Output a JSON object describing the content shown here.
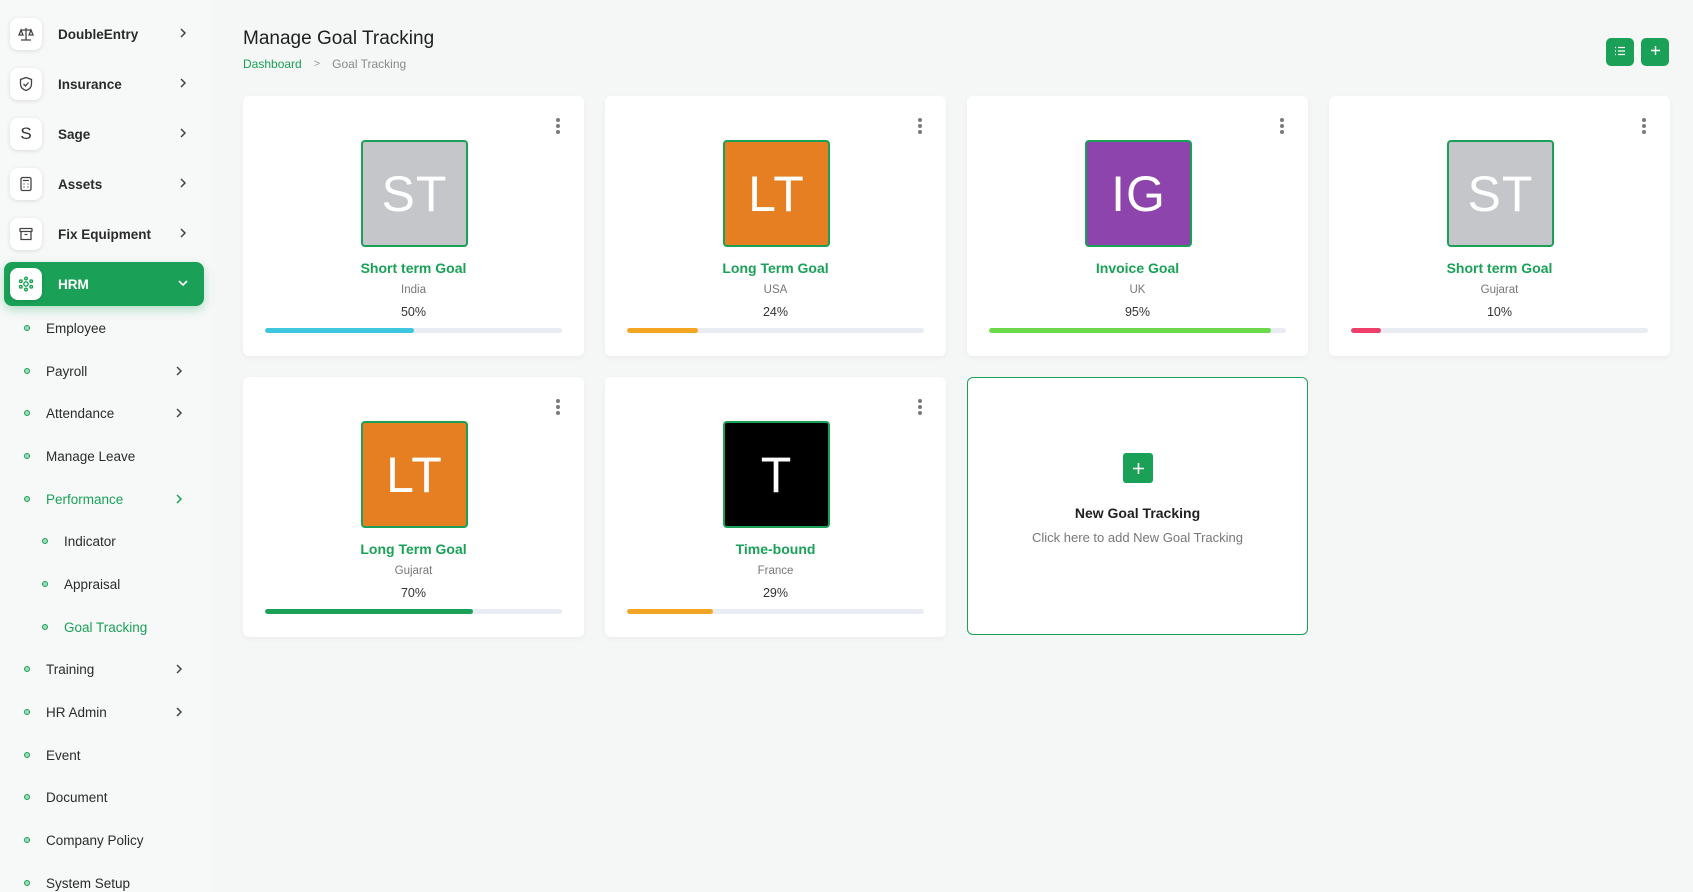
{
  "sidebar": {
    "top_items": [
      {
        "label": "DoubleEntry",
        "icon": "scale-icon"
      },
      {
        "label": "Insurance",
        "icon": "shield-icon"
      },
      {
        "label": "Sage",
        "icon": "sage-icon",
        "glyph": "S"
      },
      {
        "label": "Assets",
        "icon": "calculator-icon"
      },
      {
        "label": "Fix Equipment",
        "icon": "archive-icon"
      },
      {
        "label": "HRM",
        "icon": "hrm-icon",
        "active": true
      }
    ],
    "hrm_items": [
      {
        "label": "Employee"
      },
      {
        "label": "Payroll",
        "has_children": true
      },
      {
        "label": "Attendance",
        "has_children": true
      },
      {
        "label": "Manage Leave"
      },
      {
        "label": "Performance",
        "has_children": true,
        "expanded": true
      },
      {
        "label": "Indicator"
      },
      {
        "label": "Appraisal"
      },
      {
        "label": "Goal Tracking",
        "active": true
      },
      {
        "label": "Training",
        "has_children": true
      },
      {
        "label": "HR Admin",
        "has_children": true
      },
      {
        "label": "Event"
      },
      {
        "label": "Document"
      },
      {
        "label": "Company Policy"
      },
      {
        "label": "System Setup"
      }
    ]
  },
  "header": {
    "title": "Manage Goal Tracking",
    "breadcrumb": {
      "root": "Dashboard",
      "separator": ">",
      "current": "Goal Tracking"
    },
    "buttons": [
      {
        "icon": "list-icon"
      },
      {
        "icon": "plus-icon"
      }
    ]
  },
  "goals": [
    {
      "initials": "ST",
      "name": "Short term Goal",
      "location": "India",
      "progress_label": "50%",
      "progress": 0.5,
      "avatar_color": "#c4c6c9",
      "bar_color": "#3ec6de"
    },
    {
      "initials": "LT",
      "name": "Long Term Goal",
      "location": "USA",
      "progress_label": "24%",
      "progress": 0.24,
      "avatar_color": "#e67e22",
      "bar_color": "#f5a524"
    },
    {
      "initials": "IG",
      "name": "Invoice Goal",
      "location": "UK",
      "progress_label": "95%",
      "progress": 0.95,
      "avatar_color": "#8e44ad",
      "bar_color": "#6cd94a"
    },
    {
      "initials": "ST",
      "name": "Short term Goal",
      "location": "Gujarat",
      "progress_label": "10%",
      "progress": 0.1,
      "avatar_color": "#c4c6c9",
      "bar_color": "#ee3f6a"
    },
    {
      "initials": "LT",
      "name": "Long Term Goal",
      "location": "Gujarat",
      "progress_label": "70%",
      "progress": 0.7,
      "avatar_color": "#e67e22",
      "bar_color": "#1aa157"
    },
    {
      "initials": "T",
      "name": "Time-bound",
      "location": "France",
      "progress_label": "29%",
      "progress": 0.29,
      "avatar_color": "#000000",
      "bar_color": "#f5a524"
    }
  ],
  "new_goal": {
    "title": "New Goal Tracking",
    "subtitle": "Click here to add New Goal Tracking"
  },
  "colors": {
    "accent": "#1aa157"
  }
}
